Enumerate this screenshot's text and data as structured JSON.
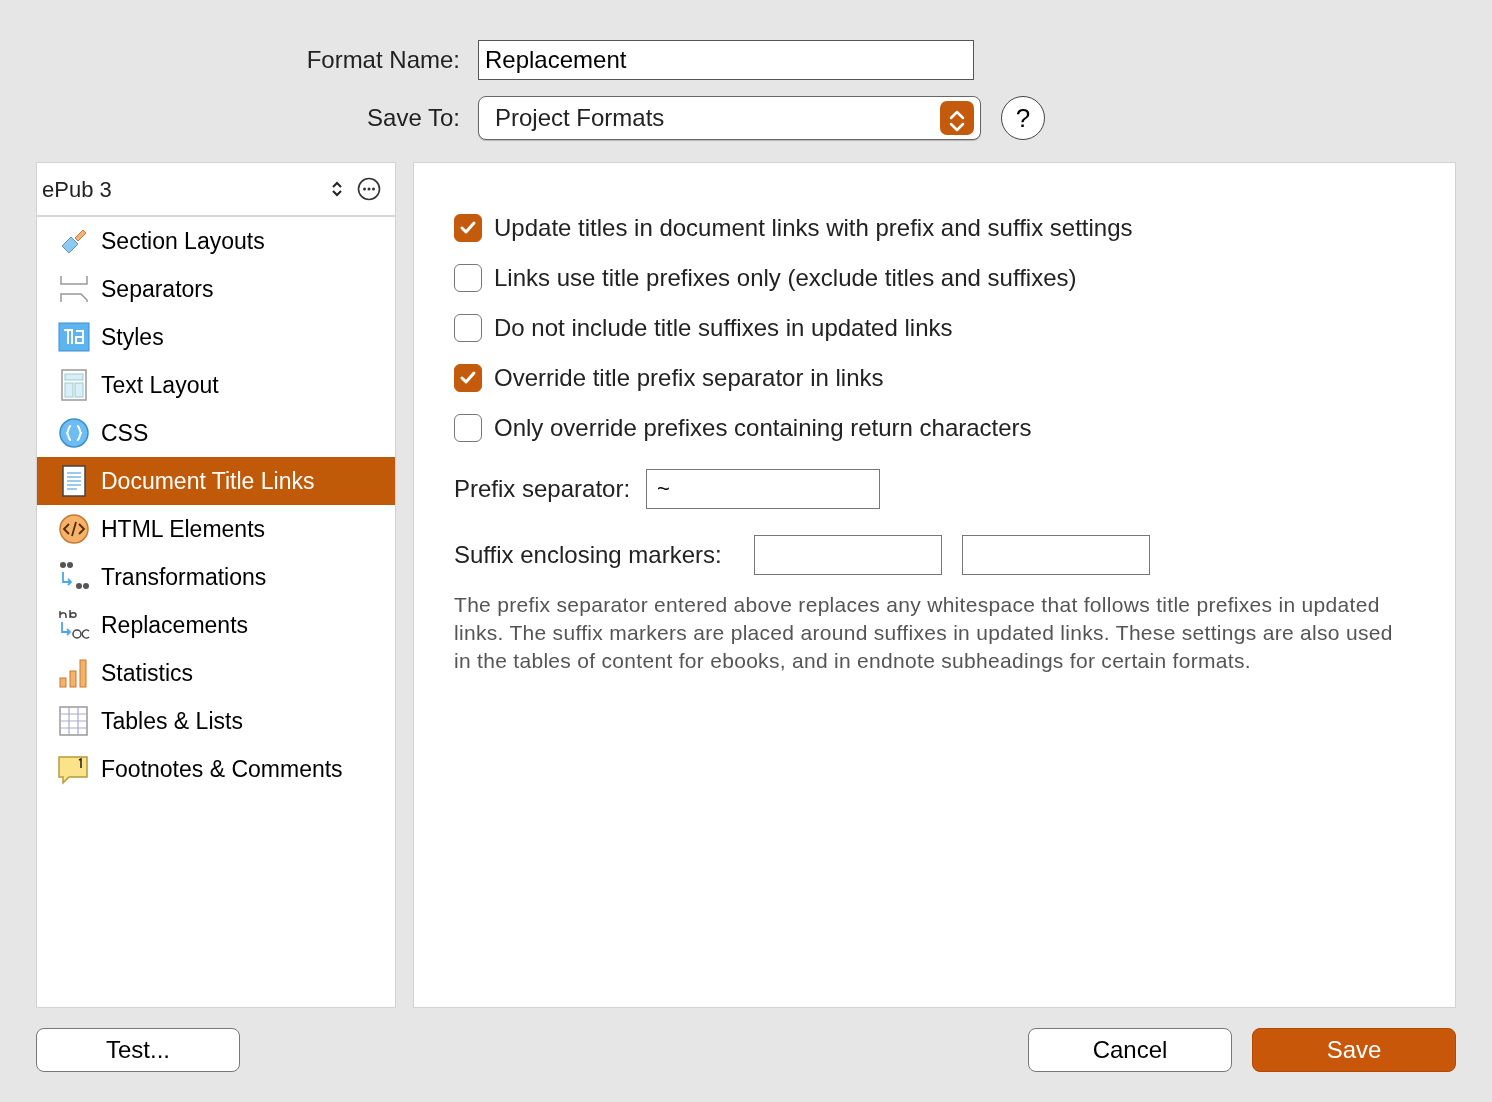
{
  "format_name": {
    "label": "Format Name:",
    "value": "Replacement"
  },
  "save_to": {
    "label": "Save To:",
    "value": "Project Formats"
  },
  "help_button": {
    "label": "?"
  },
  "sidebar": {
    "format": "ePub 3",
    "items": [
      {
        "label": "Section Layouts",
        "kind": "brush",
        "selected": false
      },
      {
        "label": "Separators",
        "kind": "separator",
        "selected": false
      },
      {
        "label": "Styles",
        "kind": "styles",
        "selected": false
      },
      {
        "label": "Text Layout",
        "kind": "layout",
        "selected": false
      },
      {
        "label": "CSS",
        "kind": "css",
        "selected": false
      },
      {
        "label": "Document Title Links",
        "kind": "document",
        "selected": true
      },
      {
        "label": "HTML Elements",
        "kind": "html",
        "selected": false
      },
      {
        "label": "Transformations",
        "kind": "quotes",
        "selected": false
      },
      {
        "label": "Replacements",
        "kind": "replace",
        "selected": false
      },
      {
        "label": "Statistics",
        "kind": "stats",
        "selected": false
      },
      {
        "label": "Tables & Lists",
        "kind": "table",
        "selected": false
      },
      {
        "label": "Footnotes & Comments",
        "kind": "footnote",
        "selected": false
      }
    ]
  },
  "options": [
    {
      "label": "Update titles in document links with prefix and suffix settings",
      "checked": true
    },
    {
      "label": "Links use title prefixes only (exclude titles and suffixes)",
      "checked": false
    },
    {
      "label": "Do not include title suffixes in updated links",
      "checked": false
    },
    {
      "label": "Override title prefix separator in links",
      "checked": true
    },
    {
      "label": "Only override prefixes containing return characters",
      "checked": false
    }
  ],
  "prefix_separator": {
    "label": "Prefix separator:",
    "value": "~"
  },
  "suffix_markers": {
    "label": "Suffix enclosing markers:"
  },
  "description": "The prefix separator entered above replaces any whitespace that follows title prefixes in updated links. The suffix markers are placed around suffixes in updated links. These settings are also used in the tables of content for ebooks, and in endnote subheadings for certain formats.",
  "buttons": {
    "test": "Test...",
    "cancel": "Cancel",
    "save": "Save"
  }
}
